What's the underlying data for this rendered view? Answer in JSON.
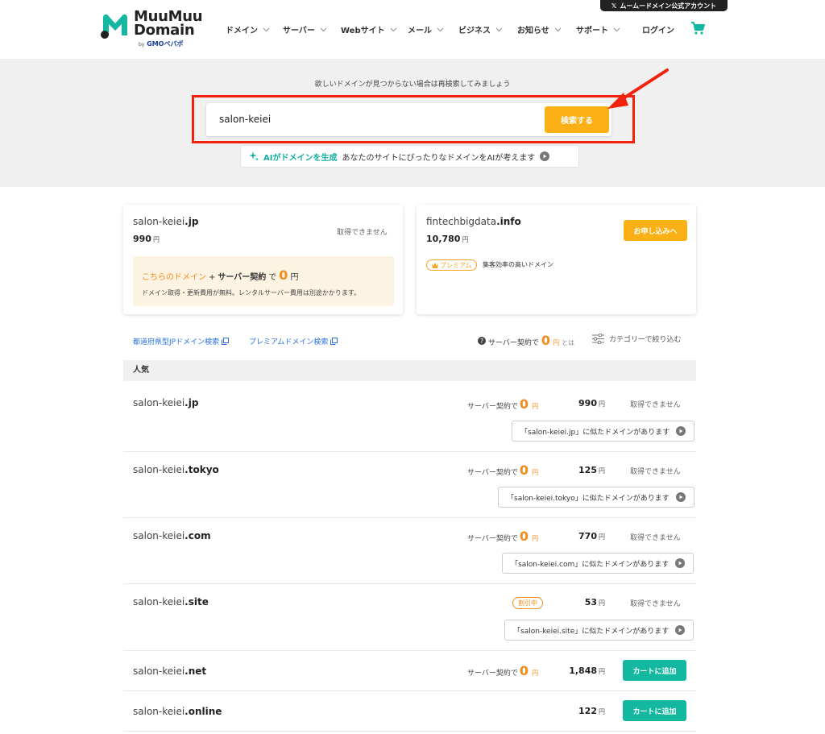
{
  "header": {
    "logo_line1": "MuuMuu",
    "logo_line2": "Domain",
    "logo_by": "by",
    "logo_sub": "GMOペパボ",
    "x_account": "ムームードメイン公式アカウント",
    "nav": [
      "ドメイン",
      "サーバー",
      "Webサイト",
      "メール",
      "ビジネス",
      "お知らせ",
      "サポート"
    ],
    "login": "ログイン",
    "brand_color": "#14b8a0"
  },
  "search": {
    "hint": "欲しいドメインが見つからない場合は再検索してみましょう",
    "value": "salon-keiei",
    "button": "検索する",
    "ai_label": "AIがドメインを生成",
    "ai_desc": "あなたのサイトにぴったりなドメインをAIが考えます"
  },
  "featured": {
    "left": {
      "name": "salon-keiei",
      "tld": ".jp",
      "price": "990",
      "yen": "円",
      "status": "取得できません",
      "promo_prefix": "こちらのドメイン",
      "promo_plus": "+",
      "promo_server": "サーバー契約",
      "promo_de": "で",
      "promo_zero": "0",
      "promo_yen": "円",
      "promo_note": "ドメイン取得・更新費用が無料。レンタルサーバー費用は別途かかります。"
    },
    "right": {
      "name": "fintechbigdata",
      "tld": ".info",
      "price": "10,780",
      "yen": "円",
      "button": "お申し込みへ",
      "badge": "プレミアム",
      "desc": "集客効率の高いドメイン"
    }
  },
  "links": {
    "jp_search": "都道府県型JPドメイン検索",
    "premium_search": "プレミアムドメイン検索",
    "info_prefix": "サーバー契約で",
    "info_zero": "0",
    "info_yen": "円",
    "info_to": "とは",
    "filter": "カテゴリーで絞り込む"
  },
  "table": {
    "category": "人気",
    "server_label": "サーバー契約で",
    "zero": "0",
    "yen": "円",
    "unavailable": "取得できません",
    "cart": "カートに追加",
    "discount": "割引中",
    "rows": [
      {
        "name": "salon-keiei",
        "tld": ".jp",
        "price": "990",
        "similar": "「salon-keiei.jp」に似たドメインがあります"
      },
      {
        "name": "salon-keiei",
        "tld": ".tokyo",
        "price": "125",
        "similar": "「salon-keiei.tokyo」に似たドメインがあります"
      },
      {
        "name": "salon-keiei",
        "tld": ".com",
        "price": "770",
        "similar": "「salon-keiei.com」に似たドメインがあります"
      },
      {
        "name": "salon-keiei",
        "tld": ".site",
        "price": "53",
        "similar": "「salon-keiei.site」に似たドメインがあります"
      },
      {
        "name": "salon-keiei",
        "tld": ".net",
        "price": "1,848"
      },
      {
        "name": "salon-keiei",
        "tld": ".online",
        "price": "122"
      }
    ]
  }
}
